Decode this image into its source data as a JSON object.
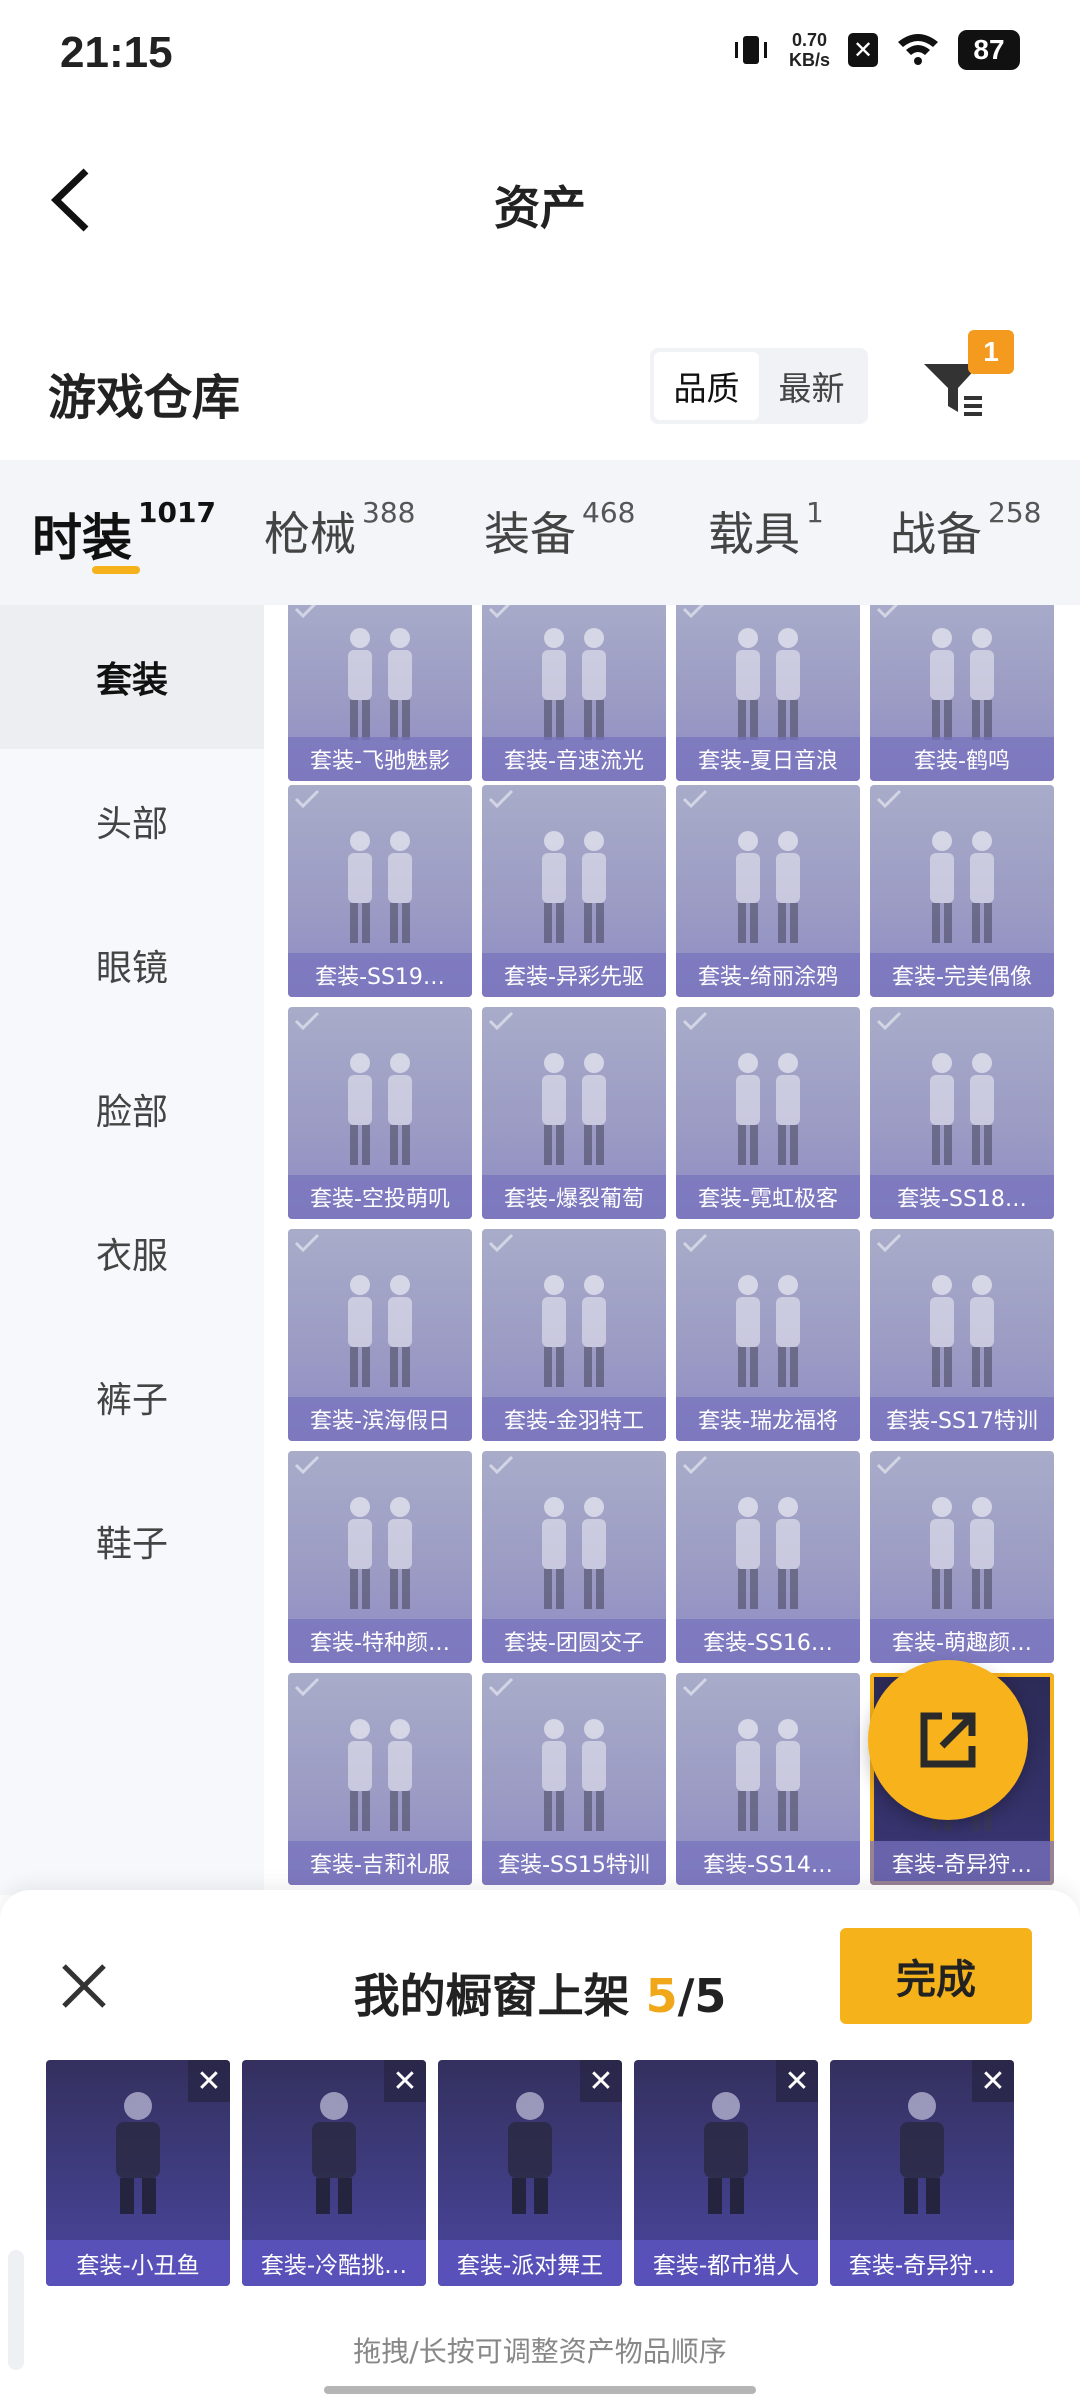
{
  "status_bar": {
    "time": "21:15",
    "speed_value": "0.70",
    "speed_unit": "KB/s",
    "battery": "87"
  },
  "header": {
    "title": "资产"
  },
  "warehouse": {
    "title": "游戏仓库",
    "sort_options": [
      "品质",
      "最新"
    ],
    "filter_badge": "1"
  },
  "tabs": [
    {
      "label": "时装",
      "count": "1017"
    },
    {
      "label": "枪械",
      "count": "388"
    },
    {
      "label": "装备",
      "count": "468"
    },
    {
      "label": "载具",
      "count": "1"
    },
    {
      "label": "战备",
      "count": "258"
    }
  ],
  "categories": [
    "套装",
    "头部",
    "眼镜",
    "脸部",
    "衣服",
    "裤子",
    "鞋子"
  ],
  "items": [
    "套装-飞驰魅影",
    "套装-音速流光",
    "套装-夏日音浪",
    "套装-鹤鸣",
    "套装-SS19…",
    "套装-异彩先驱",
    "套装-绮丽涂鸦",
    "套装-完美偶像",
    "套装-空投萌叽",
    "套装-爆裂葡萄",
    "套装-霓虹极客",
    "套装-SS18…",
    "套装-滨海假日",
    "套装-金羽特工",
    "套装-瑞龙福将",
    "套装-SS17特训",
    "套装-特种颜…",
    "套装-团圆交子",
    "套装-SS16…",
    "套装-萌趣颜…",
    "套装-吉莉礼服",
    "套装-SS15特训",
    "套装-SS14…",
    "套装-奇异狩…"
  ],
  "showcase": {
    "title_prefix": "我的橱窗上架",
    "current": "5",
    "separator": "/",
    "max": "5",
    "done_label": "完成",
    "items": [
      "套装-小丑鱼",
      "套装-冷酷挑…",
      "套装-派对舞王",
      "套装-都市猎人",
      "套装-奇异狩…"
    ],
    "hint": "拖拽/长按可调整资产物品顺序"
  },
  "colors": {
    "accent": "#f6b21a",
    "card": "#9b9ac4"
  }
}
